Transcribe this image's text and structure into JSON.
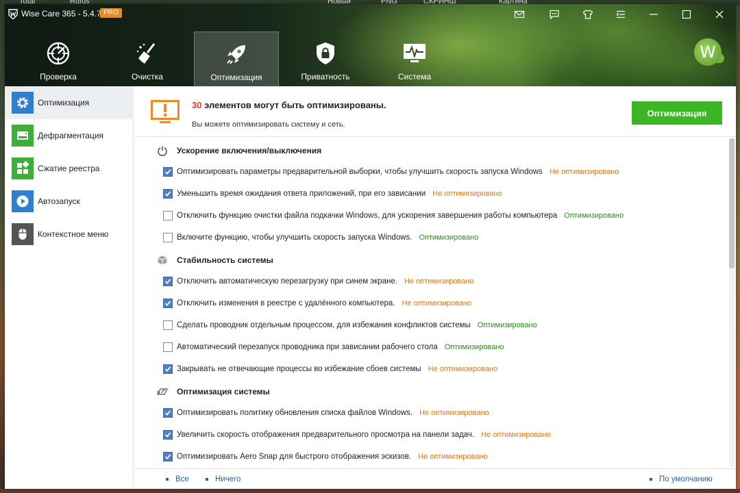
{
  "desktop": {
    "labels": [
      "Total",
      "Rufus",
      "Новый",
      "PNG",
      "СКРИНШ",
      "Картина"
    ]
  },
  "app": {
    "title": "Wise Care 365 - 5.4.7",
    "badge": "PRO",
    "avatar_letter": "W"
  },
  "titlebar_icons": [
    "mail-icon",
    "feedback-icon",
    "skin-icon",
    "menu-icon",
    "minimize-icon",
    "maximize-icon",
    "close-icon"
  ],
  "nav": [
    {
      "label": "Проверка",
      "icon": "check-icon",
      "active": false
    },
    {
      "label": "Очистка",
      "icon": "broom-icon",
      "active": false
    },
    {
      "label": "Оптимизация",
      "icon": "rocket-icon",
      "active": true
    },
    {
      "label": "Приватность",
      "icon": "lock-icon",
      "active": false
    },
    {
      "label": "Система",
      "icon": "monitor-icon",
      "active": false
    }
  ],
  "sidebar": [
    {
      "label": "Оптимизация",
      "icon": "gear-icon",
      "color": "#2f7fd1",
      "active": true
    },
    {
      "label": "Дефрагментация",
      "icon": "disk-icon",
      "color": "#3cae3a",
      "active": false
    },
    {
      "label": "Сжатие реестра",
      "icon": "registry-icon",
      "color": "#3cae3a",
      "active": false
    },
    {
      "label": "Автозапуск",
      "icon": "play-icon",
      "color": "#2f7fd1",
      "active": false
    },
    {
      "label": "Контекстное меню",
      "icon": "mouse-icon",
      "color": "#555555",
      "active": false
    }
  ],
  "summary": {
    "count": "30",
    "title_rest": " элементов могут быть оптимизированы.",
    "subtitle": "Вы можете оптимизировать систему и сеть.",
    "button": "Оптимизация"
  },
  "status_labels": {
    "bad": "Не оптимизировано",
    "good": "Оптимизировано"
  },
  "sections": [
    {
      "title": "Ускорение включения/выключения",
      "icon": "power-icon",
      "items": [
        {
          "text": "Оптимизировать параметры предварительной выборки, чтобы улучшить скорость запуска Windows",
          "checked": true,
          "status": "Не оптимизировано"
        },
        {
          "text": "Уменьшить время ожидания ответа приложений, при его зависании",
          "checked": true,
          "status": "Не оптимизировано"
        },
        {
          "text": "Отключить функцию очистки файла подкачки Windows, для ускорения завершения работы компьютера",
          "checked": false,
          "status": "Оптимизировано"
        },
        {
          "text": "Включите функцию, чтобы улучшить скорость запуска Windows.",
          "checked": false,
          "status": "Оптимизировано"
        }
      ]
    },
    {
      "title": "Стабильность системы",
      "icon": "cube-icon",
      "items": [
        {
          "text": "Отключить автоматическую перезагрузку при синем экране.",
          "checked": true,
          "status": "Не оптимизировано"
        },
        {
          "text": "Отключить изменения в реестре с удалённого компьютера.",
          "checked": true,
          "status": "Не оптимизировано"
        },
        {
          "text": "Сделать проводник отдельным процессом, для избежания конфликтов системы",
          "checked": false,
          "status": "Оптимизировано"
        },
        {
          "text": "Автоматический перезапуск проводника при зависании рабочего стола",
          "checked": false,
          "status": "Оптимизировано"
        },
        {
          "text": "Закрывать не отвечающие процессы во избежание сбоев системы",
          "checked": true,
          "status": "Не оптимизировано"
        }
      ]
    },
    {
      "title": "Оптимизация системы",
      "icon": "speed-icon",
      "items": [
        {
          "text": "Оптимизировать политику обновления списка файлов Windows.",
          "checked": true,
          "status": "Не оптимизировано"
        },
        {
          "text": "Увеличить скорость отображения предварительного просмотра на панели задач.",
          "checked": true,
          "status": "Не оптимизировано"
        },
        {
          "text": "Оптимизировать Aero Snap для быстрого отображения эскизов.",
          "checked": true,
          "status": "Не оптимизировано"
        }
      ]
    }
  ],
  "footer": {
    "all": "Все",
    "none": "Ничего",
    "default": "По умолчанию"
  }
}
